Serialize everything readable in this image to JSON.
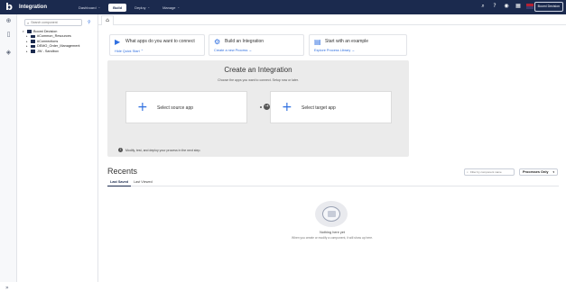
{
  "app": {
    "title": "Integration",
    "logo": "b"
  },
  "nav": [
    {
      "label": "Dashboard",
      "active": false,
      "caret": "⌄"
    },
    {
      "label": "Build",
      "active": true,
      "caret": ""
    },
    {
      "label": "Deploy",
      "active": false,
      "caret": "⌄"
    },
    {
      "label": "Manage",
      "active": false,
      "caret": "⌄"
    }
  ],
  "top_icons": [
    "search-icon",
    "help-icon",
    "notifications-icon",
    "apps-icon",
    "flag-icon"
  ],
  "account": {
    "label": "Boomi Decision"
  },
  "browser": {
    "search_placeholder": "Search component",
    "tree": [
      {
        "label": "Boomi Decision",
        "level": 0,
        "expanded": true
      },
      {
        "label": "#Common_Resources",
        "level": 1,
        "expanded": false
      },
      {
        "label": "#Connections",
        "level": 1,
        "expanded": false
      },
      {
        "label": "DEMO_Order_Management",
        "level": 1,
        "expanded": false
      },
      {
        "label": "JW - Sandbox",
        "level": 1,
        "expanded": false
      }
    ]
  },
  "cards": [
    {
      "title": "What apps do you want to connect",
      "link": "Hide Quick Start  ⌃",
      "icon": "play-icon"
    },
    {
      "title": "Build an Integration",
      "link": "Create a new Process  →",
      "icon": "build-icon"
    },
    {
      "title": "Start with an example",
      "link": "Explore Process Library  →",
      "icon": "book-icon"
    }
  ],
  "create": {
    "title": "Create an Integration",
    "subtitle": "Choose the apps you want to connect. Setup now or later.",
    "source_label": "Select source app",
    "target_label": "Select target app",
    "info": "Modify, test, and deploy your process in the next step."
  },
  "recents": {
    "title": "Recents",
    "filter_placeholder": "Filter by component name",
    "select_value": "Processes Only",
    "tabs": [
      {
        "label": "Last Saved",
        "active": true
      },
      {
        "label": "Last Viewed",
        "active": false
      }
    ],
    "empty_title": "Nothing here yet",
    "empty_sub": "When you create or modify a component, it will show up here."
  }
}
